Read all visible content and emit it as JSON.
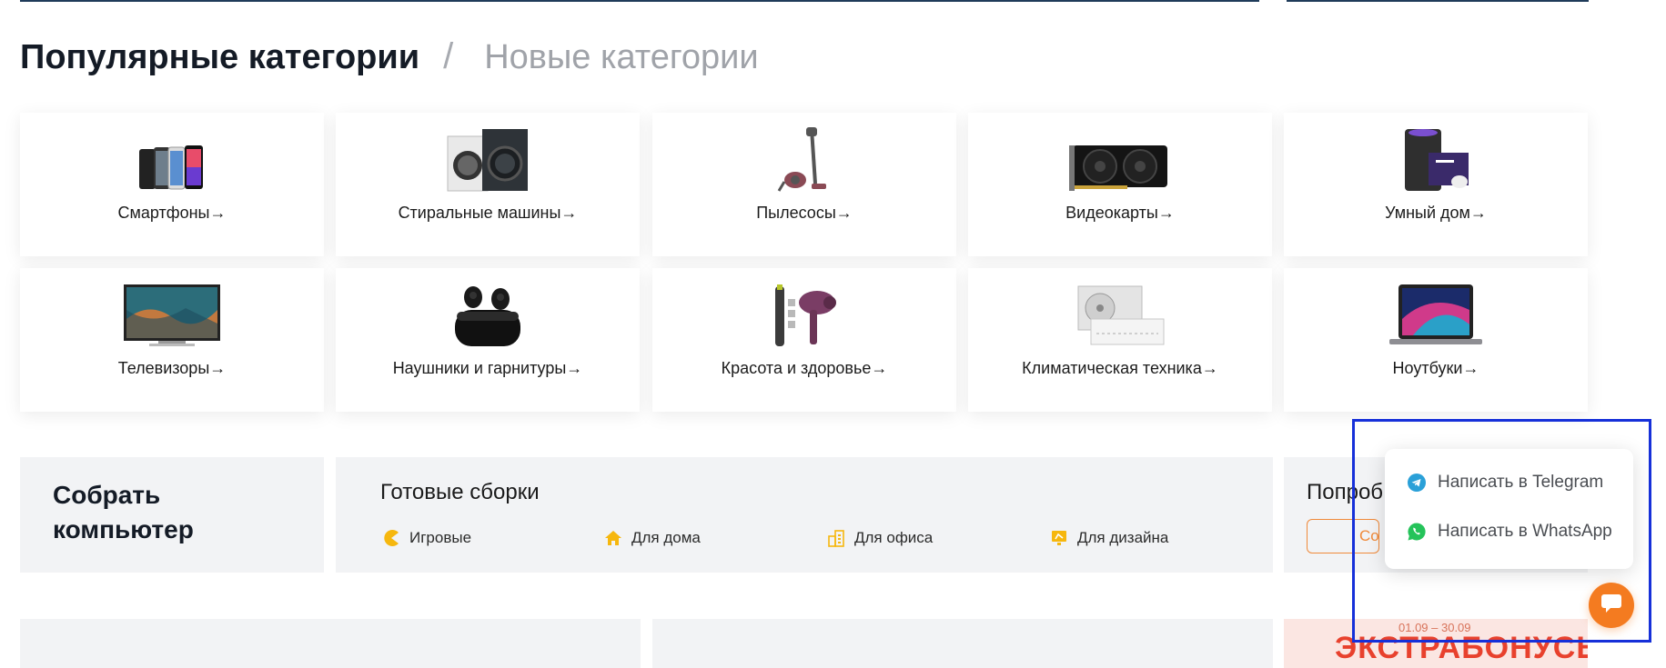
{
  "heading": {
    "active": "Популярные категории",
    "separator": "/",
    "inactive": "Новые категории"
  },
  "categories": [
    {
      "label": "Смартфоны→",
      "icon": "smartphones-image"
    },
    {
      "label": "Стиральные машины→",
      "icon": "washing-machines-image"
    },
    {
      "label": "Пылесосы→",
      "icon": "vacuum-cleaner-image"
    },
    {
      "label": "Видеокарты→",
      "icon": "graphics-card-image"
    },
    {
      "label": "Умный дом→",
      "icon": "smart-home-image"
    },
    {
      "label": "Телевизоры→",
      "icon": "tv-image"
    },
    {
      "label": "Наушники и гарнитуры→",
      "icon": "earbuds-image"
    },
    {
      "label": "Красота и здоровье→",
      "icon": "trimmer-hairdryer-image"
    },
    {
      "label": "Климатическая техника→",
      "icon": "air-conditioner-image"
    },
    {
      "label": "Ноутбуки→",
      "icon": "laptop-image"
    }
  ],
  "build_pc": {
    "title_line1": "Собрать",
    "title_line2": "компьютер"
  },
  "ready_builds": {
    "title": "Готовые сборки",
    "items": [
      {
        "label": "Игровые",
        "icon": "gaming-pacman-icon"
      },
      {
        "label": "Для дома",
        "icon": "home-icon"
      },
      {
        "label": "Для офиса",
        "icon": "office-building-icon"
      },
      {
        "label": "Для дизайна",
        "icon": "design-monitor-icon"
      }
    ]
  },
  "try_panel": {
    "text": "Попроб",
    "button": "Соз"
  },
  "promo": {
    "dates": "01.09 – 30.09",
    "headline": "ЭКСТРАБОНУСЫ"
  },
  "chat": {
    "telegram_label": "Написать в Telegram",
    "whatsapp_label": "Написать в WhatsApp"
  },
  "colors": {
    "accent": "#f47b20",
    "icon_yellow": "#f6b70e",
    "telegram": "#2aa0d8",
    "whatsapp": "#25c35a",
    "highlight": "#1630d9"
  }
}
